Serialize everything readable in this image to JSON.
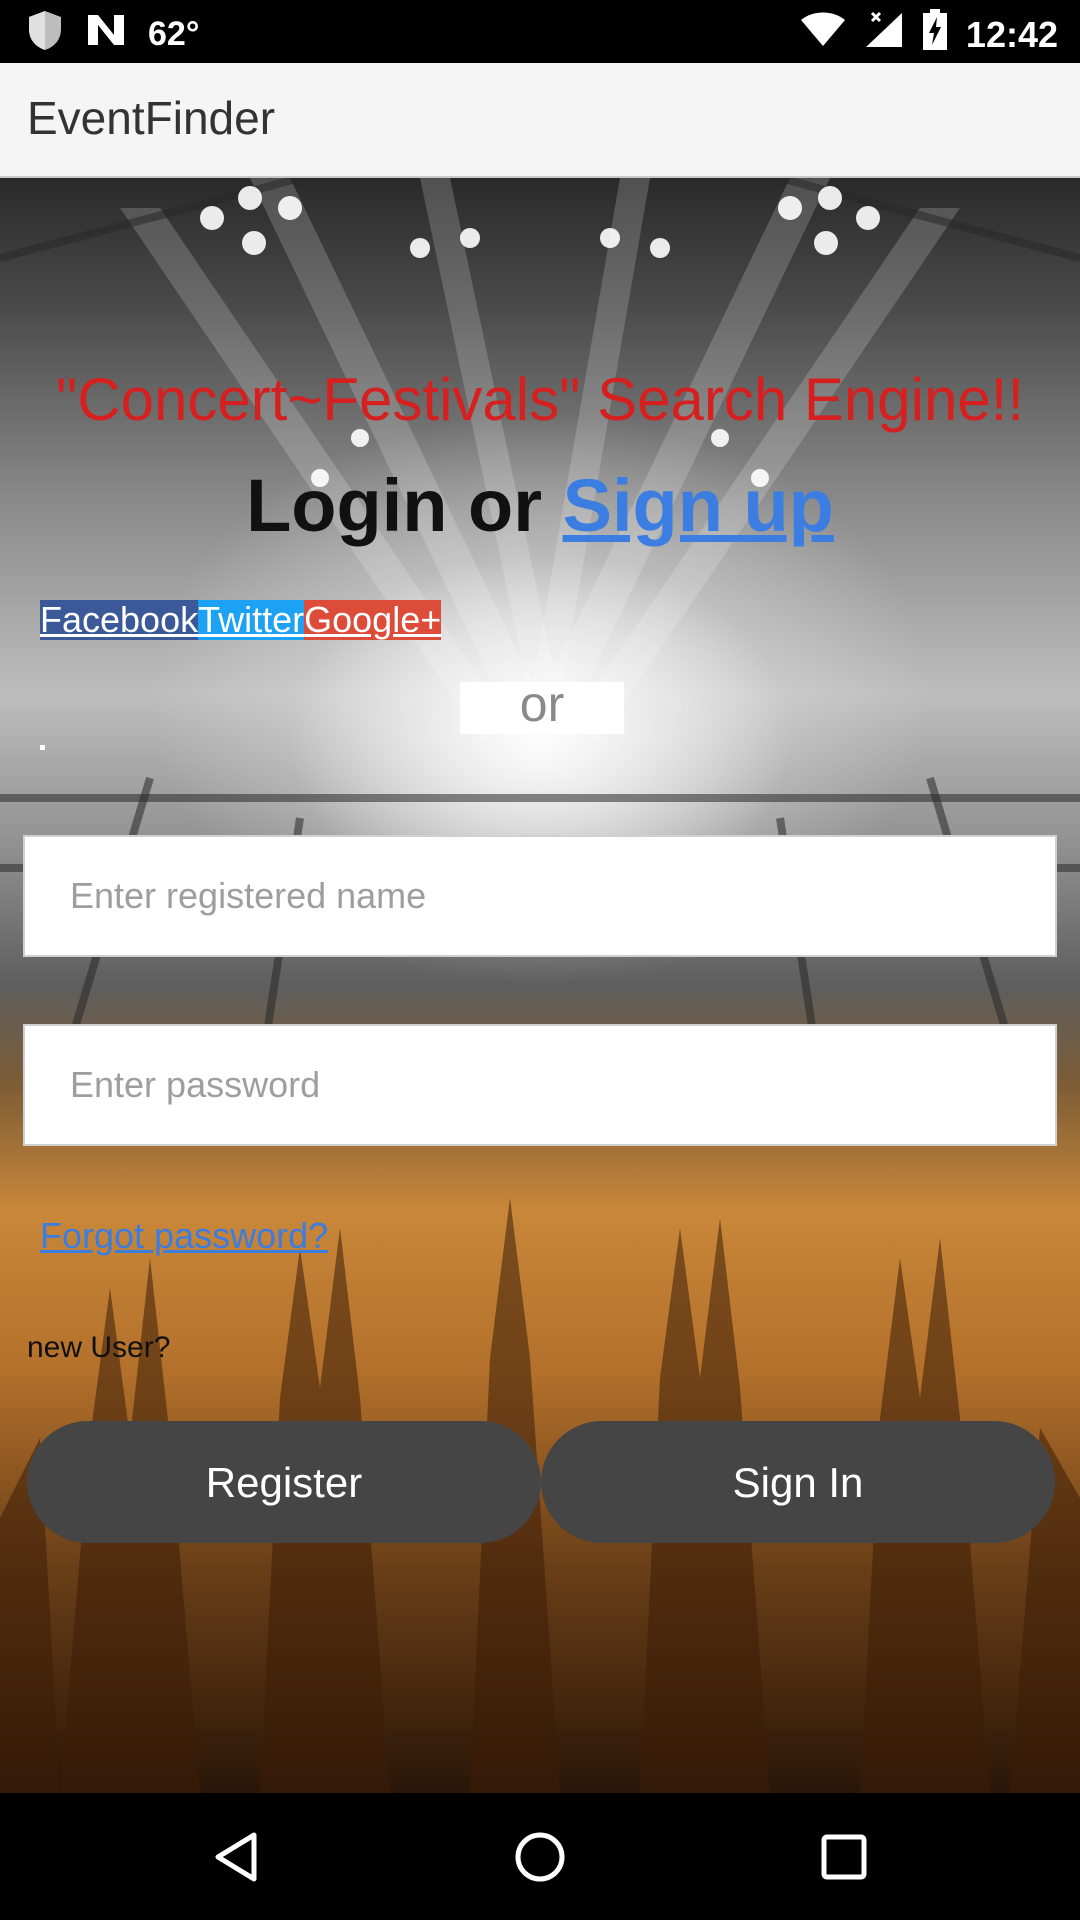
{
  "status_bar": {
    "temperature": "62°",
    "time": "12:42",
    "icons": [
      "shield-icon",
      "n-notification-icon",
      "wifi-icon",
      "cell-signal-icon",
      "battery-charging-icon"
    ]
  },
  "app_bar": {
    "title": "EventFinder"
  },
  "main": {
    "tagline": "\"Concert~Festivals\" Search Engine!!",
    "heading_prefix": "Login or ",
    "signup_link": "Sign up",
    "social": {
      "facebook": "Facebook",
      "twitter": "Twitter",
      "google": "Google+"
    },
    "or_label": "or",
    "name_field": {
      "placeholder": "Enter registered name",
      "value": ""
    },
    "password_field": {
      "placeholder": "Enter password",
      "value": ""
    },
    "forgot_link": "Forgot password?",
    "new_user_label": "new User?",
    "register_button": "Register",
    "signin_button": "Sign In"
  },
  "colors": {
    "tagline": "#d62020",
    "link": "#3b7de0",
    "button": "#454545",
    "facebook": "#3b5998",
    "twitter": "#1da1f2",
    "google": "#dd4b39"
  },
  "nav_bar": {
    "icons": [
      "back-triangle-icon",
      "home-circle-icon",
      "recents-square-icon"
    ]
  }
}
